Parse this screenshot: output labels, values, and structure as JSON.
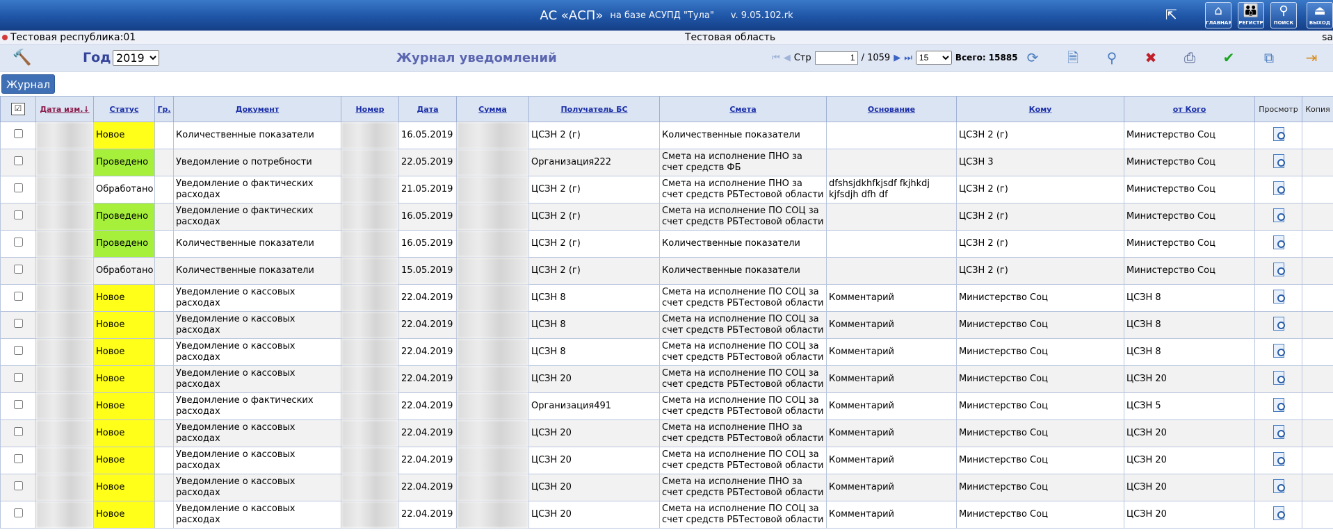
{
  "header": {
    "app_name": "АС «АСП»",
    "subtitle": "на базе АСУПД \"Тула\"",
    "version": "v. 9.05.102.rk",
    "buttons": [
      {
        "id": "home",
        "label": "ГЛАВНАЯ",
        "icon": "home-icon"
      },
      {
        "id": "registry",
        "label": "РЕГИСТР",
        "icon": "people-icon"
      },
      {
        "id": "search",
        "label": "ПОИСК",
        "icon": "search-person-icon"
      },
      {
        "id": "exit",
        "label": "ВЫХОД",
        "icon": "exit-icon"
      }
    ]
  },
  "region": {
    "left": "Тестовая республика:01",
    "center": "Тестовая область",
    "right": "sa"
  },
  "toolbar": {
    "year_label": "Год",
    "year_value": "2019",
    "title": "Журнал уведомлений",
    "page_label": "Стр",
    "page_value": "1",
    "page_total": "/ 1059",
    "page_size": "15",
    "total_label": "Всего: 15885"
  },
  "journal_button": "Журнал",
  "columns": {
    "date_changed": "Дата изм.",
    "status": "Статус",
    "group": "Гр.",
    "document": "Документ",
    "number": "Номер",
    "date": "Дата",
    "sum": "Сумма",
    "recipient": "Получатель БС",
    "estimate": "Смета",
    "basis": "Основание",
    "to": "Кому",
    "from": "от Кого",
    "view": "Просмотр",
    "copy": "Копия"
  },
  "rows": [
    {
      "status": "Новое",
      "status_color": "#ffff1a",
      "document": "Количественные показатели",
      "date": "16.05.2019",
      "recipient": "ЦСЗН 2 (г)",
      "estimate": "Количественные показатели",
      "basis": "",
      "to": "ЦСЗН 2 (г)",
      "from": "Министерство Соц"
    },
    {
      "status": "Проведено",
      "status_color": "#a6ef3a",
      "document": "Уведомление о потребности",
      "date": "22.05.2019",
      "recipient": "Организация222",
      "estimate": "Смета на исполнение ПНО за счет средств ФБ",
      "basis": "",
      "to": "ЦСЗН 3",
      "from": "Министерство Соц"
    },
    {
      "status": "Обработано",
      "status_color": "",
      "document": "Уведомление о фактических расходах",
      "date": "21.05.2019",
      "recipient": "ЦСЗН 2 (г)",
      "estimate": "Смета на исполнение ПНО за счет средств РБТестовой области",
      "basis": "dfshsjdkhfkjsdf fkjhkdj kjfsdjh dfh df",
      "to": "ЦСЗН 2 (г)",
      "from": "Министерство Соц"
    },
    {
      "status": "Проведено",
      "status_color": "#a6ef3a",
      "document": "Уведомление о фактических расходах",
      "date": "16.05.2019",
      "recipient": "ЦСЗН 2 (г)",
      "estimate": "Смета на исполнение ПО СОЦ за счет средств РБТестовой области",
      "basis": "",
      "to": "ЦСЗН 2 (г)",
      "from": "Министерство Соц"
    },
    {
      "status": "Проведено",
      "status_color": "#a6ef3a",
      "document": "Количественные показатели",
      "date": "16.05.2019",
      "recipient": "ЦСЗН 2 (г)",
      "estimate": "Количественные показатели",
      "basis": "",
      "to": "ЦСЗН 2 (г)",
      "from": "Министерство Соц"
    },
    {
      "status": "Обработано",
      "status_color": "",
      "document": "Количественные показатели",
      "date": "15.05.2019",
      "recipient": "ЦСЗН 2 (г)",
      "estimate": "Количественные показатели",
      "basis": "",
      "to": "ЦСЗН 2 (г)",
      "from": "Министерство Соц"
    },
    {
      "status": "Новое",
      "status_color": "#ffff1a",
      "document": "Уведомление о кассовых расходах",
      "date": "22.04.2019",
      "recipient": "ЦСЗН 8",
      "estimate": "Смета на исполнение ПО СОЦ за счет средств РБТестовой области",
      "basis": "Комментарий",
      "to": "Министерство Соц",
      "from": "ЦСЗН 8"
    },
    {
      "status": "Новое",
      "status_color": "#ffff1a",
      "document": "Уведомление о кассовых расходах",
      "date": "22.04.2019",
      "recipient": "ЦСЗН 8",
      "estimate": "Смета на исполнение ПО СОЦ за счет средств РБТестовой области",
      "basis": "Комментарий",
      "to": "Министерство Соц",
      "from": "ЦСЗН 8"
    },
    {
      "status": "Новое",
      "status_color": "#ffff1a",
      "document": "Уведомление о кассовых расходах",
      "date": "22.04.2019",
      "recipient": "ЦСЗН 8",
      "estimate": "Смета на исполнение ПО СОЦ за счет средств РБТестовой области",
      "basis": "Комментарий",
      "to": "Министерство Соц",
      "from": "ЦСЗН 8"
    },
    {
      "status": "Новое",
      "status_color": "#ffff1a",
      "document": "Уведомление о кассовых расходах",
      "date": "22.04.2019",
      "recipient": "ЦСЗН 20",
      "estimate": "Смета на исполнение ПО СОЦ за счет средств РБТестовой области",
      "basis": "Комментарий",
      "to": "Министерство Соц",
      "from": "ЦСЗН 20"
    },
    {
      "status": "Новое",
      "status_color": "#ffff1a",
      "document": "Уведомление о фактических расходах",
      "date": "22.04.2019",
      "recipient": "Организация491",
      "estimate": "Смета на исполнение ПО СОЦ за счет средств РБТестовой области",
      "basis": "Комментарий",
      "to": "Министерство Соц",
      "from": "ЦСЗН 5"
    },
    {
      "status": "Новое",
      "status_color": "#ffff1a",
      "document": "Уведомление о кассовых расходах",
      "date": "22.04.2019",
      "recipient": "ЦСЗН 20",
      "estimate": "Смета на исполнение ПНО за счет средств РБТестовой области",
      "basis": "Комментарий",
      "to": "Министерство Соц",
      "from": "ЦСЗН 20"
    },
    {
      "status": "Новое",
      "status_color": "#ffff1a",
      "document": "Уведомление о кассовых расходах",
      "date": "22.04.2019",
      "recipient": "ЦСЗН 20",
      "estimate": "Смета на исполнение ПО СОЦ за счет средств РБТестовой области",
      "basis": "Комментарий",
      "to": "Министерство Соц",
      "from": "ЦСЗН 20"
    },
    {
      "status": "Новое",
      "status_color": "#ffff1a",
      "document": "Уведомление о кассовых расходах",
      "date": "22.04.2019",
      "recipient": "ЦСЗН 20",
      "estimate": "Смета на исполнение ПНО за счет средств РБТестовой области",
      "basis": "Комментарий",
      "to": "Министерство Соц",
      "from": "ЦСЗН 20"
    },
    {
      "status": "Новое",
      "status_color": "#ffff1a",
      "document": "Уведомление о кассовых расходах",
      "date": "22.04.2019",
      "recipient": "ЦСЗН 20",
      "estimate": "Смета на исполнение ПО СОЦ за счет средств РБТестовой области",
      "basis": "Комментарий",
      "to": "Министерство Соц",
      "from": "ЦСЗН 20"
    }
  ]
}
